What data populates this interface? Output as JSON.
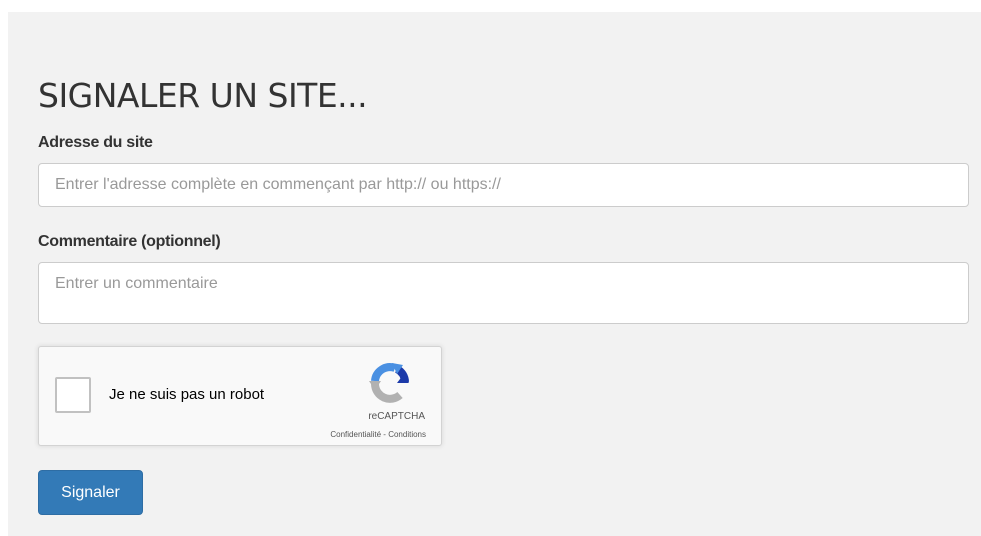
{
  "form": {
    "title": "SIGNALER UN SITE...",
    "url_label": "Adresse du site",
    "url_placeholder": "Entrer l'adresse complète en commençant par http:// ou https://",
    "url_value": "",
    "comment_label": "Commentaire (optionnel)",
    "comment_placeholder": "Entrer un commentaire",
    "comment_value": "",
    "submit_label": "Signaler"
  },
  "captcha": {
    "checkbox_label": "Je ne suis pas un robot",
    "checked": false,
    "brand": "reCAPTCHA",
    "privacy_link": "Confidentialité",
    "separator": " - ",
    "terms_link": "Conditions",
    "logo_icon": "recaptcha-logo-icon"
  },
  "colors": {
    "panel_background": "#f2f2f2",
    "button_primary": "#337ab7",
    "title_text": "#333333",
    "recaptcha_blue": "#4a90e2",
    "recaptcha_dark_blue": "#1c3aa9",
    "recaptcha_gray": "#b1b1b1"
  }
}
